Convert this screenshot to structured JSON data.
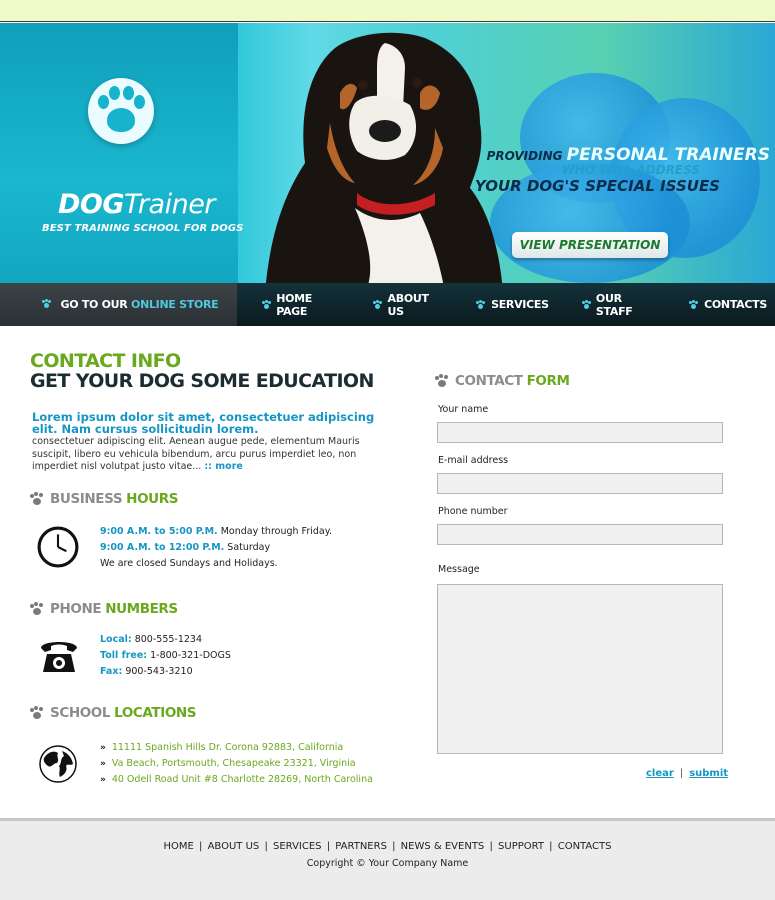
{
  "brand": {
    "logo_bold": "DOG",
    "logo_light": "Trainer",
    "tagline": "BEST TRAINING SCHOOL FOR DOGS"
  },
  "hero": {
    "line1_lead": "PROVIDING",
    "line1_highlight": "PERSONAL TRAINERS",
    "line2": "WHO WILL ADDRESS",
    "line3": "YOUR DOG'S SPECIAL ISSUES",
    "button_label": "VIEW PRESENTATION"
  },
  "nav": {
    "store_lead": "GO TO OUR",
    "store_highlight": "ONLINE STORE",
    "store_arrow": "··›",
    "items": [
      "HOME PAGE",
      "ABOUT US",
      "SERVICES",
      "OUR STAFF",
      "CONTACTS"
    ]
  },
  "contact": {
    "heading1": "CONTACT INFO",
    "heading2": "GET YOUR DOG SOME EDUCATION",
    "intro_bold": "Lorem ipsum dolor sit amet, consectetuer adipiscing elit. Nam cursus sollicitudin lorem.",
    "intro_text": "consectetuer adipiscing elit. Aenean augue pede, elementum Mauris suscipit, libero eu vehicula bibendum, arcu purus imperdiet leo, non imperdiet nisl volutpat justo vitae...",
    "more_label": ":: more"
  },
  "hours": {
    "title_gray": "BUSINESS",
    "title_green": "HOURS",
    "row1_time": "9:00 A.M. to 5:00 P.M.",
    "row1_days": "Monday through Friday.",
    "row2_time": "9:00 A.M. to 12:00 P.M.",
    "row2_days": "Saturday",
    "closed": "We are closed Sundays and Holidays."
  },
  "phones": {
    "title_gray": "PHONE",
    "title_green": "NUMBERS",
    "local_label": "Local:",
    "local_value": "800-555-1234",
    "tollfree_label": "Toll free:",
    "tollfree_value": "1-800-321-DOGS",
    "fax_label": "Fax:",
    "fax_value": "900-543-3210"
  },
  "locations": {
    "title_gray": "SCHOOL",
    "title_green": "LOCATIONS",
    "bullet": "»",
    "items": [
      "11111 Spanish Hills Dr. Corona 92883, California",
      "Va Beach, Portsmouth, Chesapeake 23321, Virginia",
      "40 Odell Road Unit #8 Charlotte 28269, North Carolina"
    ]
  },
  "form": {
    "title_gray": "CONTACT",
    "title_green": "FORM",
    "name_label": "Your name",
    "email_label": "E-mail address",
    "phone_label": "Phone number",
    "message_label": "Message",
    "clear_label": "clear",
    "separator": "|",
    "submit_label": "submit"
  },
  "footer": {
    "links": [
      "HOME",
      "ABOUT US",
      "SERVICES",
      "PARTNERS",
      "NEWS & EVENTS",
      "SUPPORT",
      "CONTACTS"
    ],
    "separator": "|",
    "copyright": "Copyright © Your Company Name"
  }
}
